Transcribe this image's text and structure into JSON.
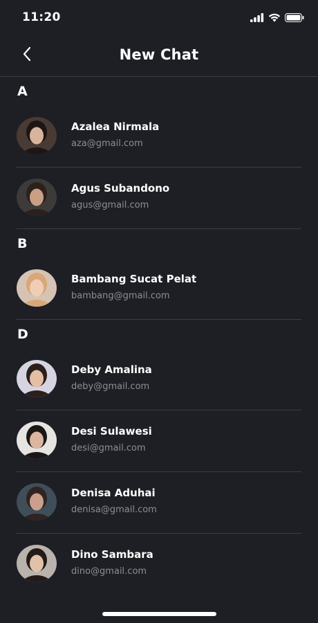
{
  "status_bar": {
    "time": "11:20"
  },
  "header": {
    "title": "New Chat"
  },
  "sections": [
    {
      "letter": "A",
      "contacts": [
        {
          "name": "Azalea Nirmala",
          "email": "aza@gmail.com",
          "avatar_bg": "#4a3a34",
          "avatar_face": "#d8b49c",
          "avatar_hair": "#1e1614"
        },
        {
          "name": "Agus Subandono",
          "email": "agus@gmail.com",
          "avatar_bg": "#3d3b3a",
          "avatar_face": "#c99f86",
          "avatar_hair": "#2b211c"
        }
      ]
    },
    {
      "letter": "B",
      "contacts": [
        {
          "name": "Bambang Sucat Pelat",
          "email": "bambang@gmail.com",
          "avatar_bg": "#d6c3b4",
          "avatar_face": "#f0cdb6",
          "avatar_hair": "#d9a778"
        }
      ]
    },
    {
      "letter": "D",
      "contacts": [
        {
          "name": "Deby Amalina",
          "email": "deby@gmail.com",
          "avatar_bg": "#d7d4e2",
          "avatar_face": "#e4bfa6",
          "avatar_hair": "#2a1f1b"
        },
        {
          "name": "Desi Sulawesi",
          "email": "desi@gmail.com",
          "avatar_bg": "#e6e4e0",
          "avatar_face": "#dcb7a0",
          "avatar_hair": "#1b1717"
        },
        {
          "name": "Denisa Aduhai",
          "email": "denisa@gmail.com",
          "avatar_bg": "#3f4e58",
          "avatar_face": "#caa08c",
          "avatar_hair": "#2f2421"
        },
        {
          "name": "Dino Sambara",
          "email": "dino@gmail.com",
          "avatar_bg": "#b9b2ad",
          "avatar_face": "#e2c1aa",
          "avatar_hair": "#241b18"
        }
      ]
    }
  ],
  "colors": {
    "background": "#1e1f25",
    "divider": "#3d3e46",
    "text_primary": "#ffffff",
    "text_secondary": "#8d8e96"
  }
}
